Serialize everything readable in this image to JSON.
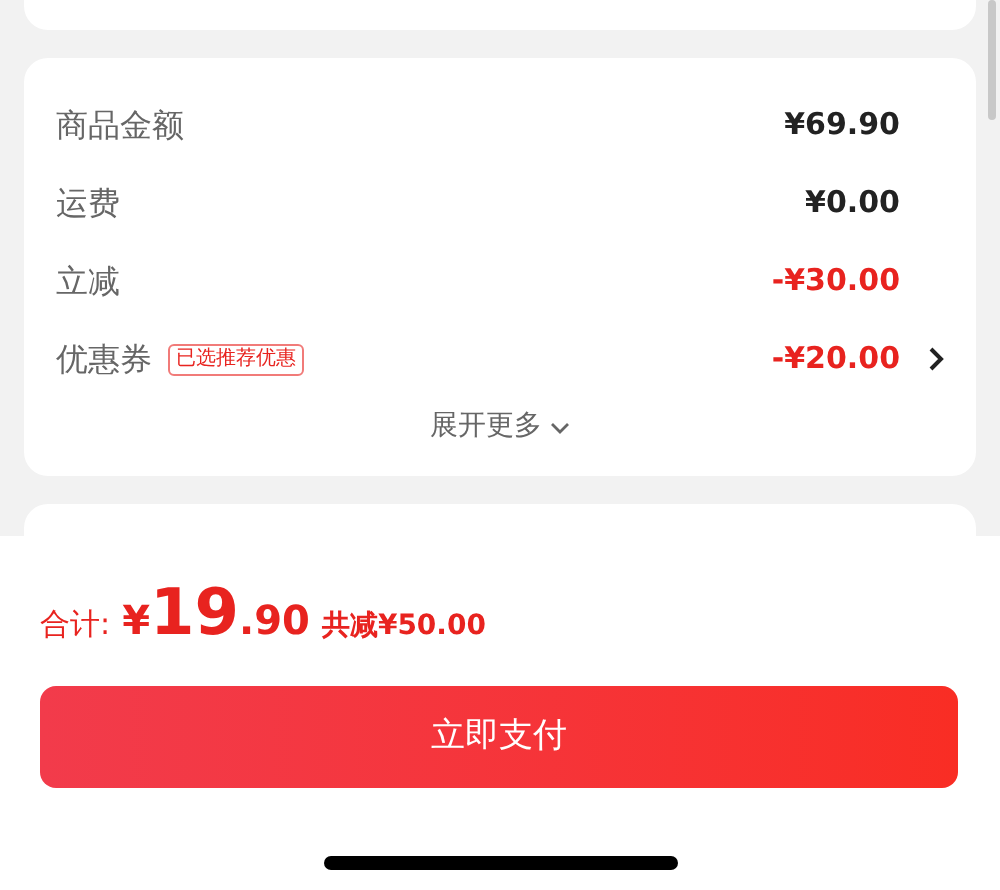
{
  "price_rows": [
    {
      "label": "商品金额",
      "amount": "¥69.90",
      "kind": "normal"
    },
    {
      "label": "运费",
      "amount": "¥0.00",
      "kind": "normal"
    },
    {
      "label": "立减",
      "amount": "-¥30.00",
      "kind": "discount"
    },
    {
      "label": "优惠券",
      "tag": "已选推荐优惠",
      "amount": "-¥20.00",
      "kind": "discount",
      "link": true
    }
  ],
  "expand": {
    "label": "展开更多"
  },
  "footer": {
    "total_label": "合计:",
    "currency": "¥",
    "integer": "19",
    "decimal": ".90",
    "saved": "共减¥50.00",
    "pay_button": "立即支付"
  }
}
